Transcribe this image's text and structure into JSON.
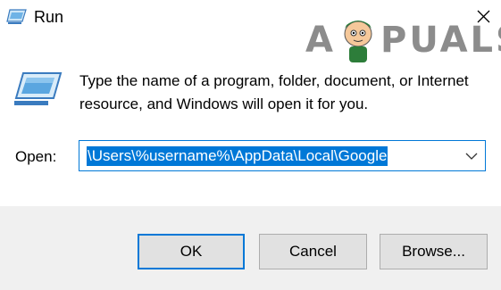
{
  "window": {
    "title": "Run",
    "title_icon": "run-icon",
    "close_icon": "close-icon"
  },
  "watermark": {
    "text_a": "A",
    "text_rest": "PUALS"
  },
  "dialog": {
    "icon": "run-dialog-icon",
    "description": "Type the name of a program, folder, document, or Internet resource, and Windows will open it for you.",
    "open_label": "Open:",
    "open_value": "\\Users\\%username%\\AppData\\Local\\Google",
    "dropdown_icon": "chevron-down-icon"
  },
  "buttons": {
    "ok": "OK",
    "cancel": "Cancel",
    "browse": "Browse..."
  },
  "colors": {
    "accent": "#0078d7",
    "footer": "#f0f0f0",
    "button": "#e1e1e1"
  }
}
